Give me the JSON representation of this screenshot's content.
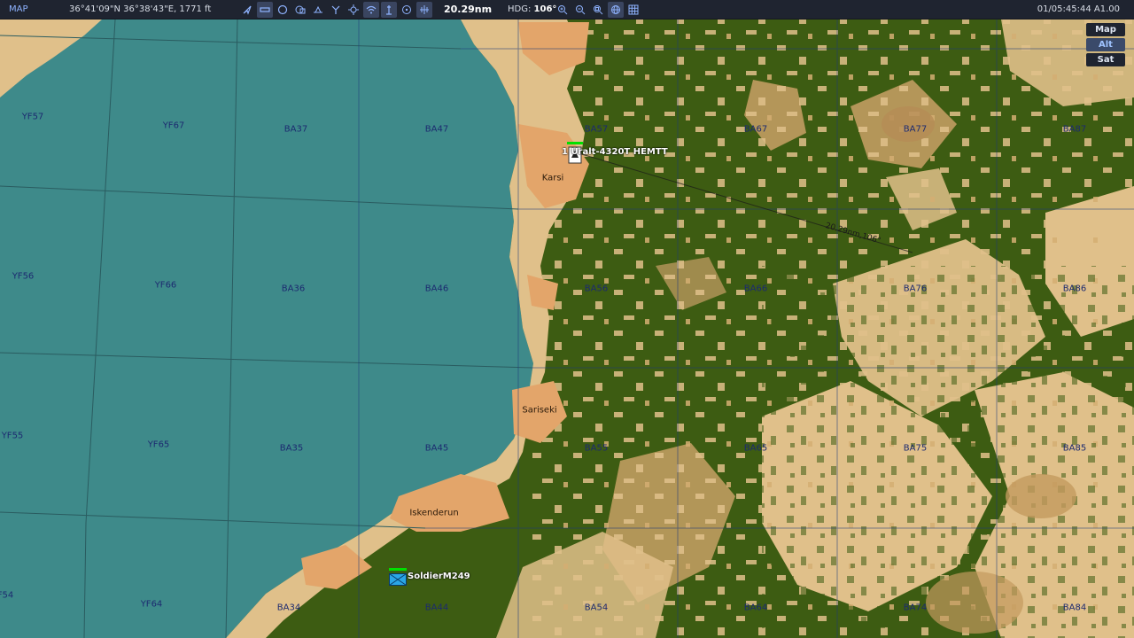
{
  "topbar": {
    "mode": "MAP",
    "coords": "36°41'09\"N 36°38'43\"E, 1771 ft",
    "distance": "20.29nm",
    "hdg_label": "HDG:",
    "hdg_value": "106°",
    "time": "01/05:45:44 A1.00"
  },
  "tools": [
    "pointer-icon",
    "ruler-icon",
    "circle-icon",
    "layers-icon",
    "sam-icon",
    "route-icon",
    "target-icon",
    "wifi-icon",
    "tower-icon",
    "chat-icon",
    "freq-icon"
  ],
  "zoom_tools": [
    "zoom-in-icon",
    "zoom-out-icon",
    "zoom-fit-icon",
    "globe-icon",
    "grid-icon"
  ],
  "layers": {
    "map": "Map",
    "alt": "Alt",
    "sat": "Sat",
    "active": "Alt"
  },
  "grid_labels": {
    "yf57": "YF57",
    "yf67": "YF67",
    "ba37": "BA37",
    "ba47": "BA47",
    "ba57": "BA57",
    "ba67": "BA67",
    "ba77": "BA77",
    "ba87": "BA87",
    "yf56": "YF56",
    "yf66": "YF66",
    "ba36": "BA36",
    "ba46": "BA46",
    "ba56": "BA56",
    "ba66": "BA66",
    "ba76": "BA76",
    "ba86": "BA86",
    "yf55": "YF55",
    "yf65": "YF65",
    "ba35": "BA35",
    "ba45": "BA45",
    "ba55": "BA55",
    "ba65": "BA65",
    "ba75": "BA75",
    "ba85": "BA85",
    "f54": "F54",
    "yf64": "YF64",
    "ba34": "BA34",
    "ba44": "BA44",
    "ba54": "BA54",
    "ba64": "BA64",
    "ba74": "BA74",
    "ba84": "BA84"
  },
  "towns": {
    "karsi": "Karsi",
    "sariseki": "Sariseki",
    "iskenderun": "Iskenderun"
  },
  "units": {
    "vehicle": "1 Uralt-4320T HEMTT",
    "soldier": "SoldierM249"
  },
  "measure": "20.29nm,106°",
  "colors": {
    "sea": "#3e8a8a",
    "forest": "#3d5c12",
    "open": "#e0c08a",
    "urban": "#e3a56a",
    "grid_sea": "#2a5c60",
    "grid_land": "#223808",
    "friendly": "#00e000",
    "unit_blue": "#2aa6e6"
  }
}
